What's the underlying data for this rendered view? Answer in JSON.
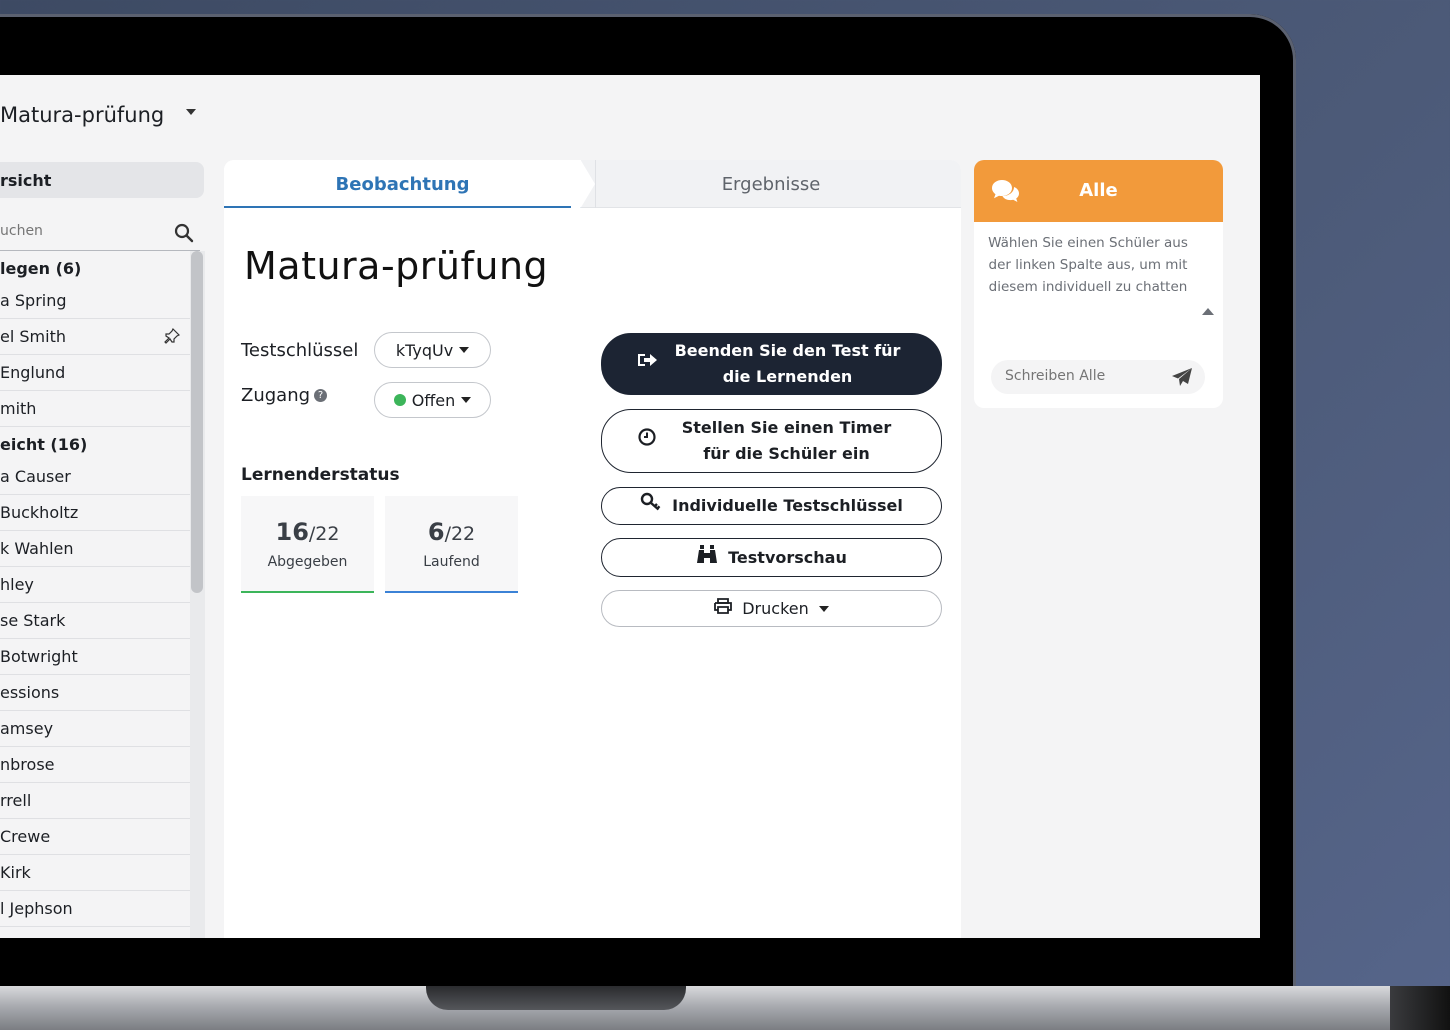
{
  "topbar": {
    "title": "Matura-prüfung"
  },
  "sidebar": {
    "header": "rsicht",
    "search_placeholder": "uchen",
    "items": [
      {
        "label": "legen (6)",
        "group": true
      },
      {
        "label": "a Spring"
      },
      {
        "label": "el Smith",
        "pinned": true
      },
      {
        "label": "Englund"
      },
      {
        "label": "mith"
      },
      {
        "label": "eicht (16)",
        "group": true
      },
      {
        "label": "a Causer"
      },
      {
        "label": "Buckholtz"
      },
      {
        "label": "k Wahlen"
      },
      {
        "label": "hley"
      },
      {
        "label": "se Stark"
      },
      {
        "label": "Botwright"
      },
      {
        "label": "essions"
      },
      {
        "label": "amsey"
      },
      {
        "label": "nbrose"
      },
      {
        "label": "rrell"
      },
      {
        "label": "Crewe"
      },
      {
        "label": "Kirk"
      },
      {
        "label": "l Jephson"
      }
    ]
  },
  "tabs": [
    {
      "label": "Beobachtung",
      "active": true
    },
    {
      "label": "Ergebnisse",
      "active": false
    }
  ],
  "main": {
    "title": "Matura-prüfung",
    "key_label": "Testschlüssel",
    "key_value": "kTyqUv",
    "access_label": "Zugang",
    "access_value": "Offen",
    "status_label": "Lernenderstatus",
    "stats": [
      {
        "value": "16",
        "total": "/22",
        "label": "Abgegeben",
        "color": "#3cb55a"
      },
      {
        "value": "6",
        "total": "/22",
        "label": "Laufend",
        "color": "#3b82d6"
      }
    ],
    "buttons": {
      "end_test": "Beenden Sie den Test für die Lernenden",
      "set_timer": "Stellen Sie einen Timer für die Schüler ein",
      "individual_keys": "Individuelle Testschlüssel",
      "preview": "Testvorschau",
      "print": "Drucken"
    }
  },
  "chat": {
    "title": "Alle",
    "info": "Wählen Sie einen Schüler aus der linken Spalte aus, um mit diesem individuell zu chatten",
    "input_placeholder": "Schreiben Alle",
    "accent": "#f29a3b"
  }
}
